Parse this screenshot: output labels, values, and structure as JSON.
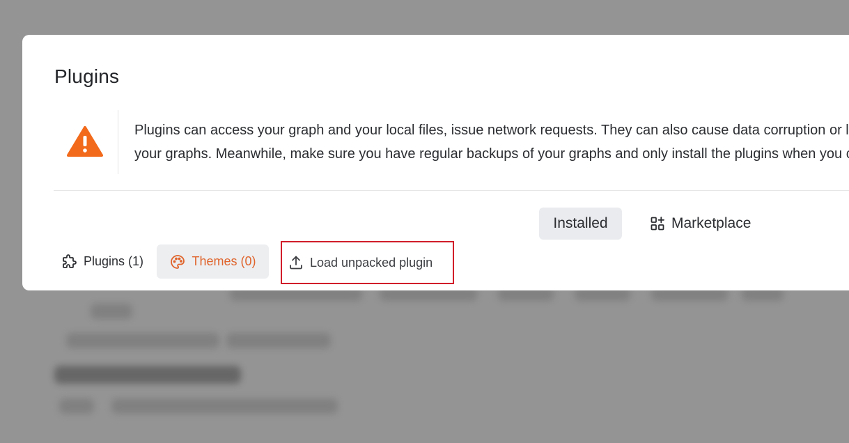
{
  "modal": {
    "title": "Plugins",
    "warning_line1": "Plugins can access your graph and your local files, issue network requests. They can also cause data corruption or loss. We're working on proper access rules for your graphs.",
    "warning_line2": "your graphs. Meanwhile, make sure you have regular backups of your graphs and only install the plugins when you can read their source code."
  },
  "tabs": {
    "installed_label": "Installed",
    "marketplace_label": "Marketplace"
  },
  "toolbar": {
    "plugins_label": "Plugins (1)",
    "themes_label": "Themes (0)",
    "load_label": "Load unpacked plugin"
  },
  "colors": {
    "accent": "#e0642c",
    "warning": "#f26a1b",
    "highlight_box": "#d11d2a"
  },
  "icons": [
    "warning-icon",
    "grid-plus-icon",
    "puzzle-icon",
    "palette-icon",
    "upload-icon"
  ]
}
